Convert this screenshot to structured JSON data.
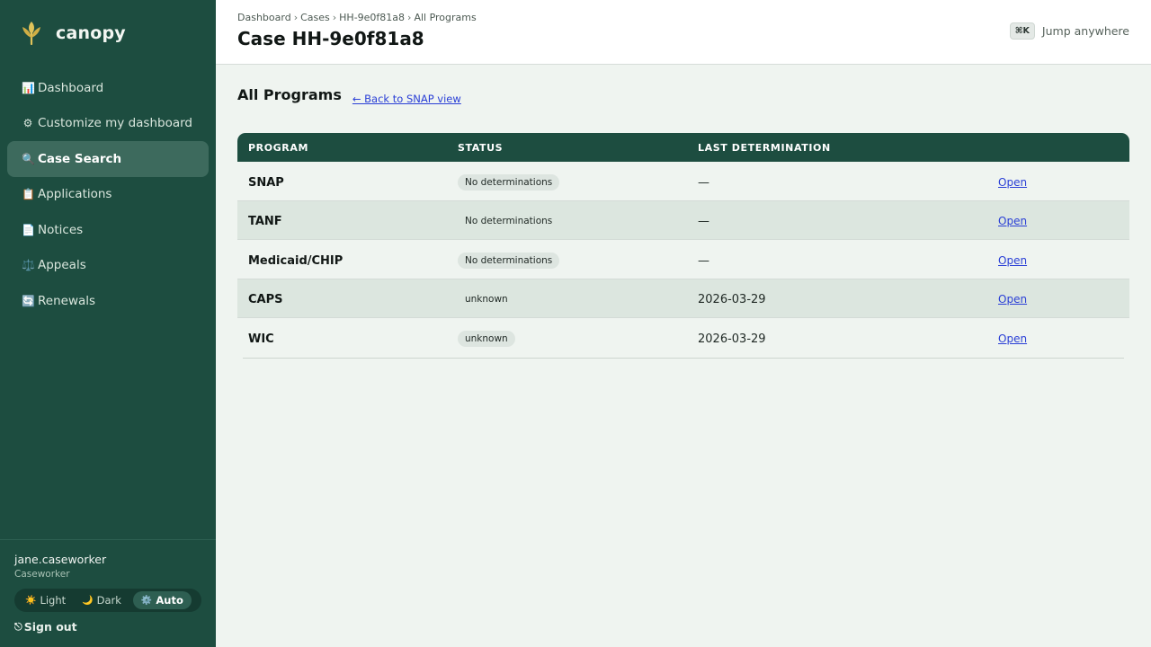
{
  "app": {
    "name": "canopy",
    "colors": {
      "sidebar": "#1d4d40",
      "sidebar_active": "#3d6a5d",
      "accent": "#1d4d40",
      "link": "#2a3fd6",
      "logo_leaf": "#e0c35a"
    }
  },
  "sidebar": {
    "items": [
      {
        "icon": "📊",
        "label": "Dashboard",
        "icon_name": "bar-chart-icon"
      },
      {
        "icon": "⚙",
        "label": "Customize my dashboard",
        "icon_name": "gear-icon"
      },
      {
        "icon": "🔍",
        "label": "Case Search",
        "icon_name": "magnifier-icon",
        "active": true
      },
      {
        "icon": "📋",
        "label": "Applications",
        "icon_name": "clipboard-icon"
      },
      {
        "icon": "📄",
        "label": "Notices",
        "icon_name": "document-icon"
      },
      {
        "icon": "⚖️",
        "label": "Appeals",
        "icon_name": "scales-icon"
      },
      {
        "icon": "🔄",
        "label": "Renewals",
        "icon_name": "cycle-icon"
      }
    ],
    "user": {
      "name": "jane.caseworker",
      "role": "Caseworker"
    },
    "theme": {
      "options": [
        {
          "icon": "☀️",
          "label": "Light"
        },
        {
          "icon": "🌙",
          "label": "Dark"
        },
        {
          "icon": "⚙️",
          "label": "Auto",
          "active": true
        }
      ]
    },
    "signout": {
      "icon": "⎋",
      "label": "Sign out"
    }
  },
  "header": {
    "breadcrumb": [
      "Dashboard",
      "Cases",
      "HH-9e0f81a8",
      "All Programs"
    ],
    "separator": "›",
    "title": "Case HH-9e0f81a8",
    "jump": {
      "kbd": "⌘K",
      "label": "Jump anywhere"
    }
  },
  "main": {
    "section_title": "All Programs",
    "back_link": "← Back to SNAP view",
    "table": {
      "columns": [
        "PROGRAM",
        "STATUS",
        "LAST DETERMINATION",
        ""
      ],
      "rows": [
        {
          "program": "SNAP",
          "status": "No determinations",
          "last_determination": "—",
          "action": "Open"
        },
        {
          "program": "TANF",
          "status": "No determinations",
          "last_determination": "—",
          "action": "Open"
        },
        {
          "program": "Medicaid/CHIP",
          "status": "No determinations",
          "last_determination": "—",
          "action": "Open"
        },
        {
          "program": "CAPS",
          "status": "unknown",
          "last_determination": "2026-03-29",
          "action": "Open"
        },
        {
          "program": "WIC",
          "status": "unknown",
          "last_determination": "2026-03-29",
          "action": "Open"
        }
      ]
    }
  }
}
